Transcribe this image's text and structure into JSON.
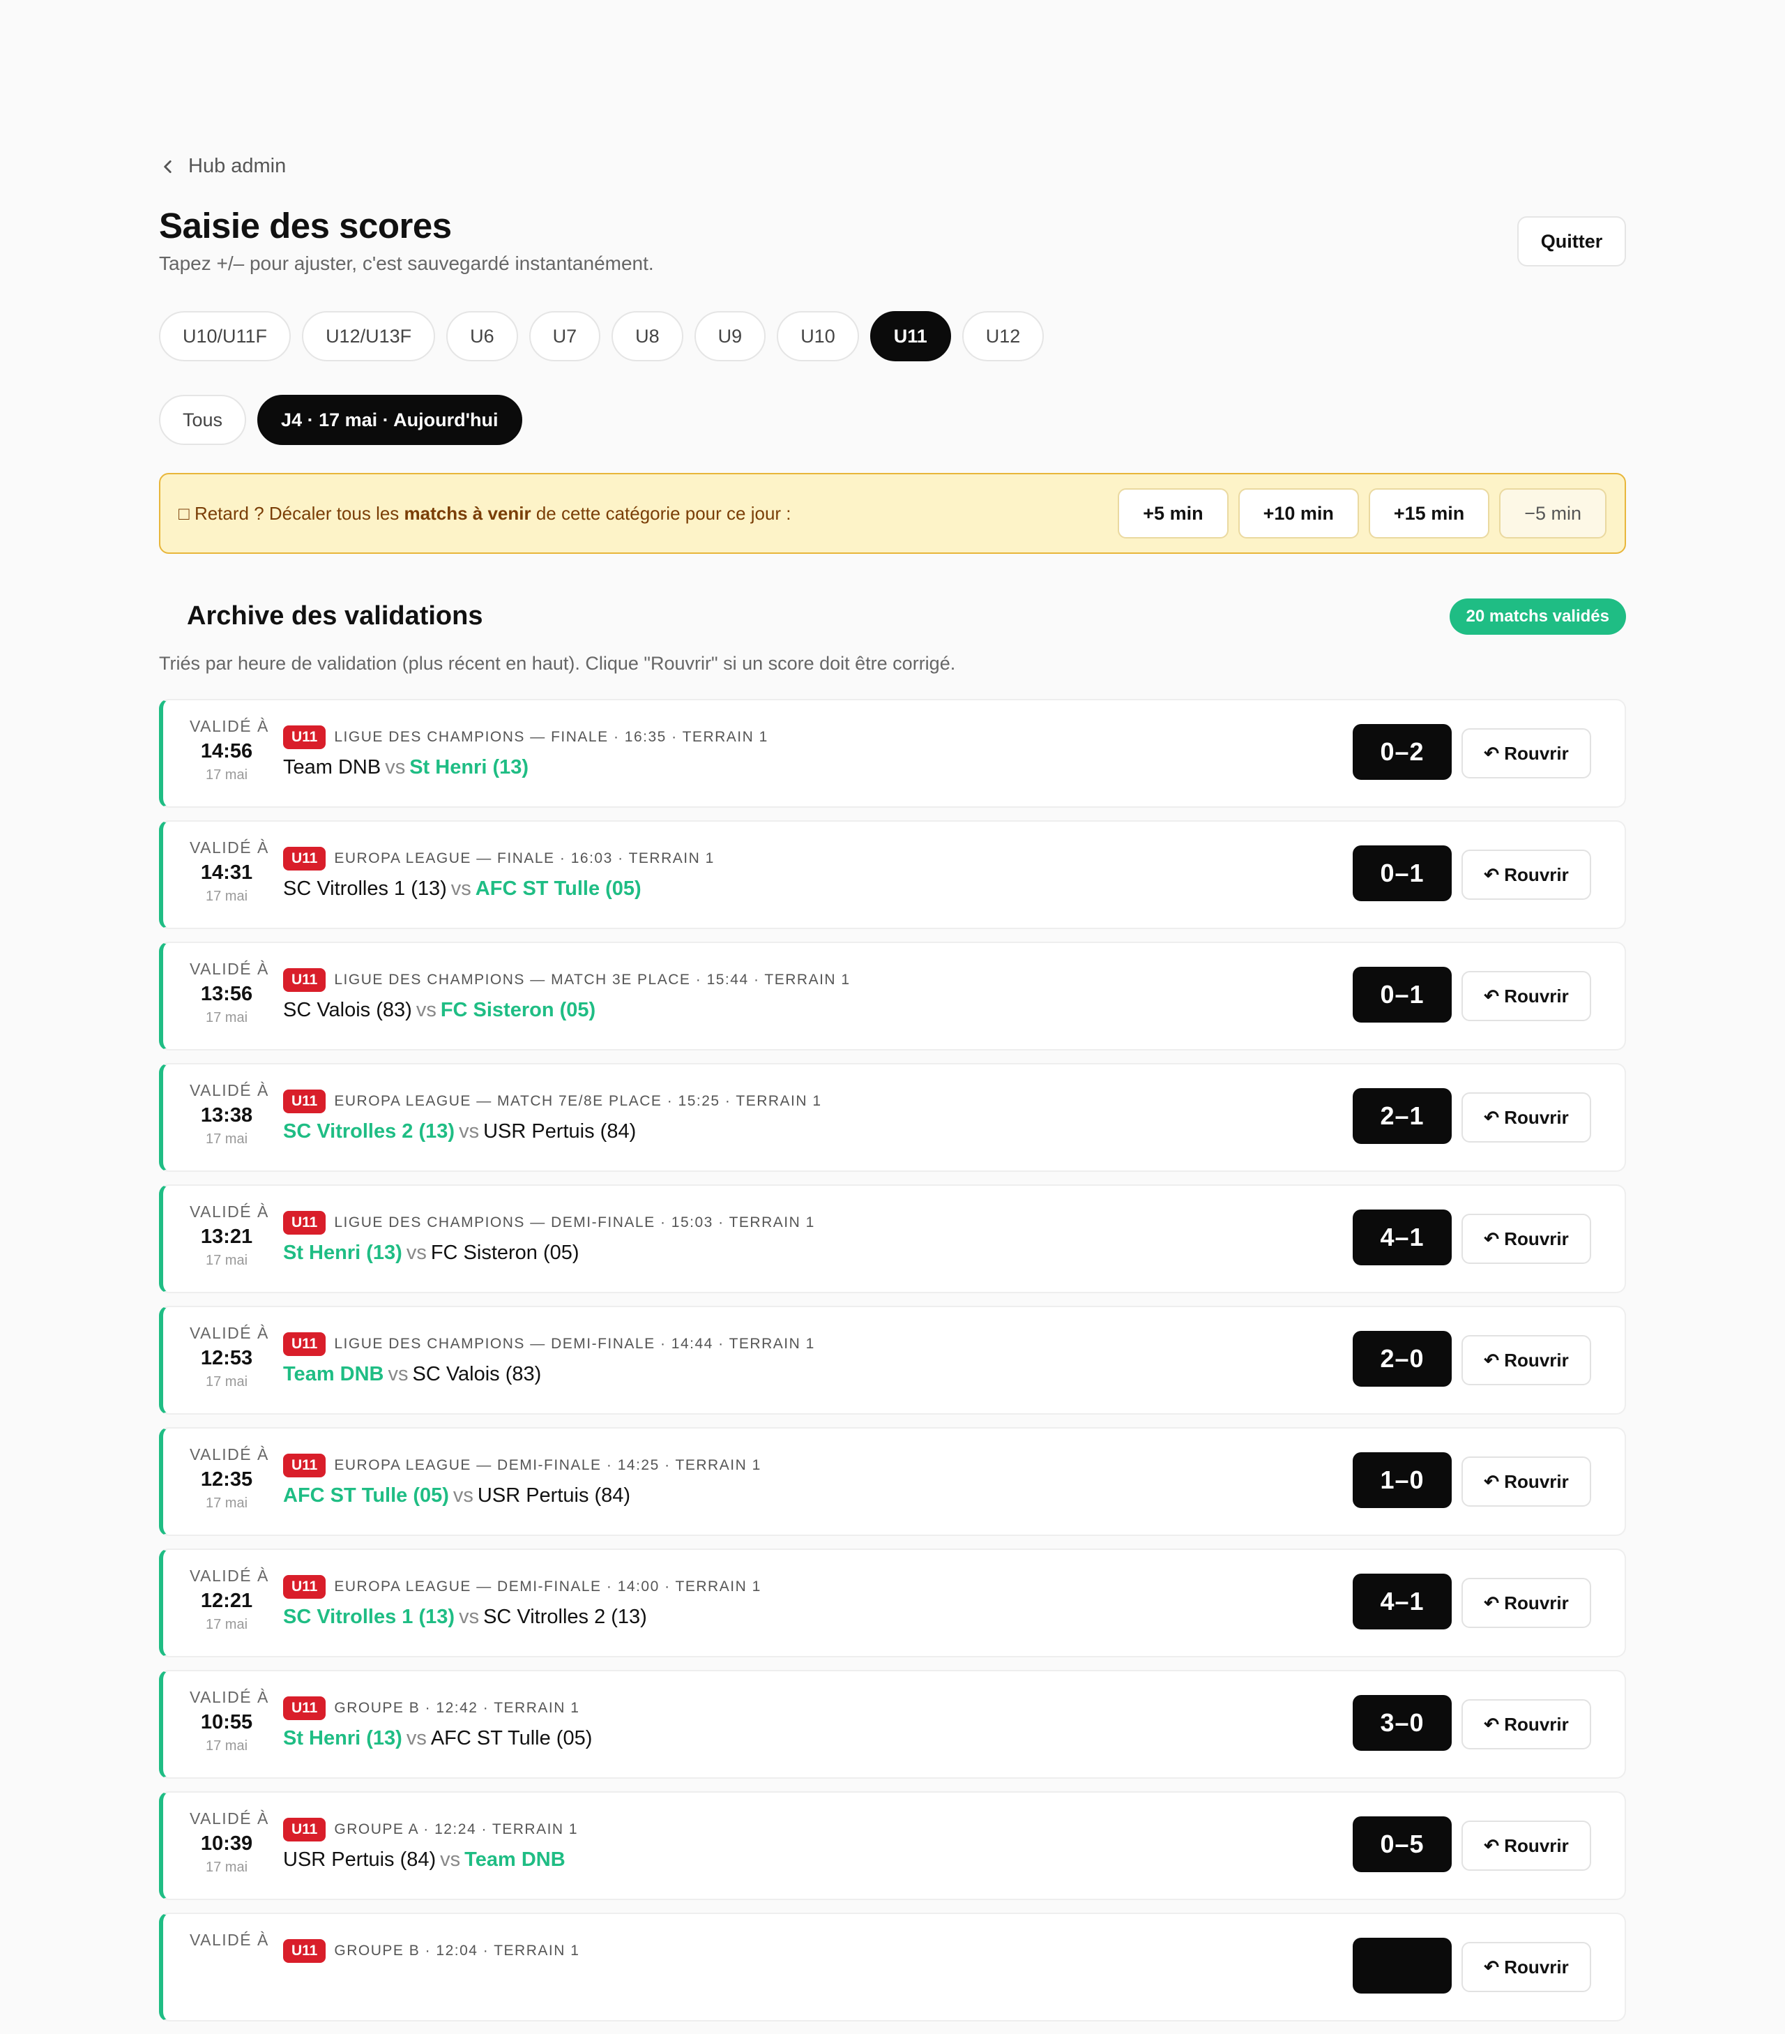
{
  "nav": {
    "back_label": "Hub admin"
  },
  "header": {
    "title": "Saisie des scores",
    "subtitle": "Tapez +/– pour ajuster, c'est sauvegardé instantanément.",
    "quit_label": "Quitter"
  },
  "categories": [
    {
      "label": "U10/U11F",
      "active": false
    },
    {
      "label": "U12/U13F",
      "active": false
    },
    {
      "label": "U6",
      "active": false
    },
    {
      "label": "U7",
      "active": false
    },
    {
      "label": "U8",
      "active": false
    },
    {
      "label": "U9",
      "active": false
    },
    {
      "label": "U10",
      "active": false
    },
    {
      "label": "U11",
      "active": true
    },
    {
      "label": "U12",
      "active": false
    }
  ],
  "days": [
    {
      "label": "Tous",
      "active": false
    },
    {
      "label": "J4 · 17 mai · Aujourd'hui",
      "active": true
    }
  ],
  "delay_banner": {
    "icon": "□",
    "text_before": " Retard ? Décaler tous les ",
    "text_bold": "matchs à venir",
    "text_after": " de cette catégorie pour ce jour :",
    "buttons": [
      "+5 min",
      "+10 min",
      "+15 min",
      "−5 min"
    ]
  },
  "archive": {
    "title": "Archive des validations",
    "count_badge": "20 matchs validés",
    "description": "Triés par heure de validation (plus récent en haut). Clique \"Rouvrir\" si un score doit être corrigé.",
    "validated_label": "VALIDÉ À",
    "reopen_label": "↶ Rouvrir",
    "rows": [
      {
        "time": "14:56",
        "date": "17 mai",
        "cat": "U11",
        "meta": "LIGUE DES CHAMPIONS — FINALE · 16:35 · TERRAIN 1",
        "home": "Team DNB",
        "away": "St Henri (13)",
        "winner": "away",
        "score": "0–2"
      },
      {
        "time": "14:31",
        "date": "17 mai",
        "cat": "U11",
        "meta": "EUROPA LEAGUE — FINALE · 16:03 · TERRAIN 1",
        "home": "SC Vitrolles 1 (13)",
        "away": "AFC ST Tulle (05)",
        "winner": "away",
        "score": "0–1"
      },
      {
        "time": "13:56",
        "date": "17 mai",
        "cat": "U11",
        "meta": "LIGUE DES CHAMPIONS — MATCH 3E PLACE · 15:44 · TERRAIN 1",
        "home": "SC Valois (83)",
        "away": "FC Sisteron (05)",
        "winner": "away",
        "score": "0–1"
      },
      {
        "time": "13:38",
        "date": "17 mai",
        "cat": "U11",
        "meta": "EUROPA LEAGUE — MATCH 7E/8E PLACE · 15:25 · TERRAIN 1",
        "home": "SC Vitrolles 2 (13)",
        "away": "USR Pertuis (84)",
        "winner": "home",
        "score": "2–1"
      },
      {
        "time": "13:21",
        "date": "17 mai",
        "cat": "U11",
        "meta": "LIGUE DES CHAMPIONS — DEMI-FINALE · 15:03 · TERRAIN 1",
        "home": "St Henri (13)",
        "away": "FC Sisteron (05)",
        "winner": "home",
        "score": "4–1"
      },
      {
        "time": "12:53",
        "date": "17 mai",
        "cat": "U11",
        "meta": "LIGUE DES CHAMPIONS — DEMI-FINALE · 14:44 · TERRAIN 1",
        "home": "Team DNB",
        "away": "SC Valois (83)",
        "winner": "home",
        "score": "2–0"
      },
      {
        "time": "12:35",
        "date": "17 mai",
        "cat": "U11",
        "meta": "EUROPA LEAGUE — DEMI-FINALE · 14:25 · TERRAIN 1",
        "home": "AFC ST Tulle (05)",
        "away": "USR Pertuis (84)",
        "winner": "home",
        "score": "1–0"
      },
      {
        "time": "12:21",
        "date": "17 mai",
        "cat": "U11",
        "meta": "EUROPA LEAGUE — DEMI-FINALE · 14:00 · TERRAIN 1",
        "home": "SC Vitrolles 1 (13)",
        "away": "SC Vitrolles 2 (13)",
        "winner": "home",
        "score": "4–1"
      },
      {
        "time": "10:55",
        "date": "17 mai",
        "cat": "U11",
        "meta": "GROUPE B · 12:42 · TERRAIN 1",
        "home": "St Henri (13)",
        "away": "AFC ST Tulle (05)",
        "winner": "home",
        "score": "3–0"
      },
      {
        "time": "10:39",
        "date": "17 mai",
        "cat": "U11",
        "meta": "GROUPE A · 12:24 · TERRAIN 1",
        "home": "USR Pertuis (84)",
        "away": "Team DNB",
        "winner": "away",
        "score": "0–5"
      },
      {
        "time": "",
        "date": "",
        "cat": "U11",
        "meta": "GROUPE B · 12:04 · TERRAIN 1",
        "home": "",
        "away": "",
        "winner": "",
        "score": ""
      }
    ]
  },
  "colors": {
    "accent_green": "#1fbd84",
    "category_red": "#d91e2a",
    "active_black": "#0b0b0b",
    "banner_bg": "#fdf3c8",
    "banner_border": "#e8b63a"
  }
}
